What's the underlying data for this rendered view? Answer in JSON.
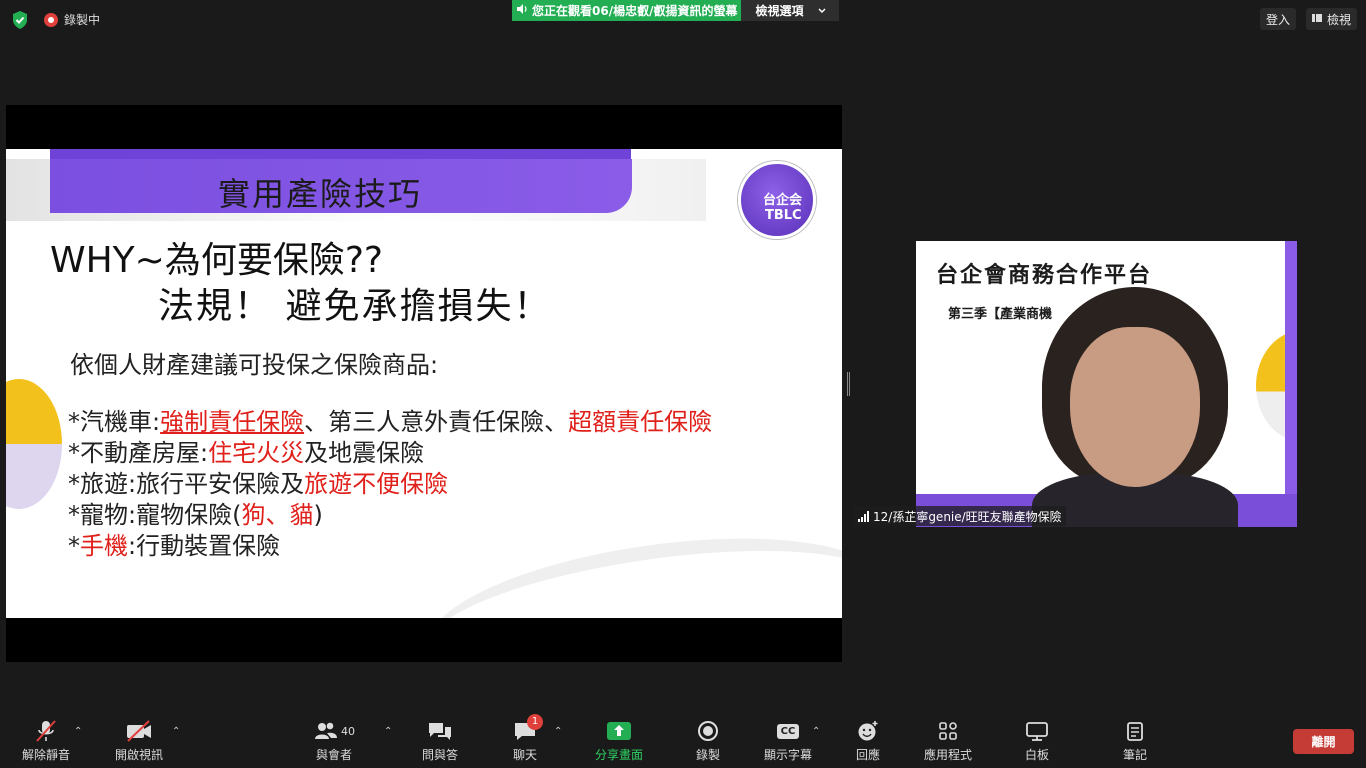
{
  "topbar": {
    "recording_label": "錄製中",
    "viewing_label": "您正在觀看06/楊忠叡/叡揚資訊的螢幕",
    "view_options_label": "檢視選項",
    "login_label": "登入",
    "view_label": "檢視"
  },
  "slide": {
    "title": "實用產險技巧",
    "logo_line1": "台企会",
    "logo_line2": "TBLC",
    "why": "WHY~為何要保險??",
    "law": "法規！ 避免承擔損失！",
    "intro": "依個人財產建議可投保之保險商品:",
    "line1_a": "*汽機車:",
    "line1_b": "強制責任保險",
    "line1_c": "、第三人意外責任保險、",
    "line1_d": "超額責任保險",
    "line2_a": "*不動產房屋:",
    "line2_b": "住宅火災",
    "line2_c": "及地震保險",
    "line3_a": "*旅遊:旅行平安保險及",
    "line3_b": "旅遊不便保險",
    "line4_a": "*寵物:寵物保險(",
    "line4_b": "狗、貓",
    "line4_c": ")",
    "line5_a": "*",
    "line5_b": "手機",
    "line5_c": ":行動裝置保險"
  },
  "video": {
    "title": "台企會商務合作平台",
    "subtitle": "第三季【產業商機",
    "participant_name": "12/孫芷寧genie/旺旺友聯產物保險"
  },
  "toolbar": {
    "unmute": "解除靜音",
    "start_video": "開啟視訊",
    "participants": "與會者",
    "participant_count": "40",
    "qa": "問與答",
    "chat": "聊天",
    "chat_badge": "1",
    "share_screen": "分享畫面",
    "record": "錄製",
    "captions": "顯示字幕",
    "captions_icon_text": "CC",
    "reactions": "回應",
    "apps": "應用程式",
    "whiteboard": "白板",
    "notes": "筆記",
    "leave": "離開"
  },
  "colors": {
    "accent_purple": "#7b4fe0",
    "share_green": "#23ae54",
    "leave_red": "#c53b36",
    "highlight_red": "#e0201b"
  }
}
